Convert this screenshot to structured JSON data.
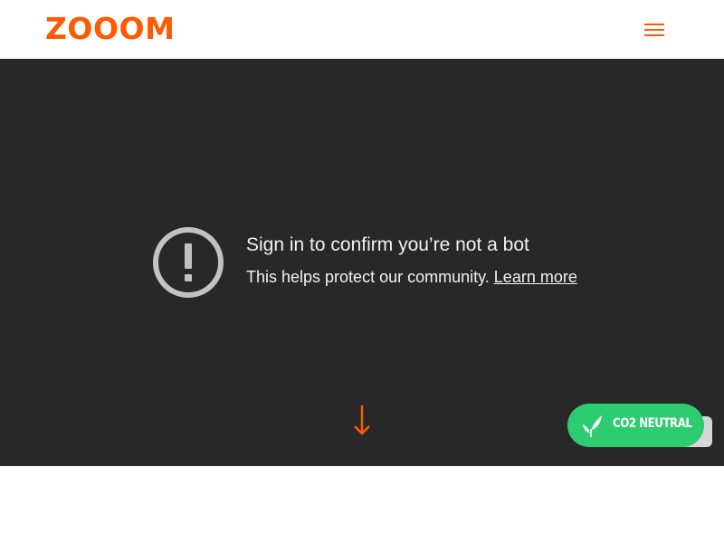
{
  "brand": {
    "logo_text": "ZOOOM",
    "accent_color": "#ff5a00"
  },
  "header": {
    "menu_icon": "hamburger-menu-icon"
  },
  "notice": {
    "icon": "exclamation-circle-icon",
    "title": "Sign in to confirm you’re not a bot",
    "subtitle": "This helps protect our community.",
    "link_label": "Learn more"
  },
  "hero": {
    "background_color": "#282828",
    "scroll_icon": "arrow-down-icon"
  },
  "co2_badge": {
    "label": "CO2 NEUTRAL",
    "icon": "leaf-icon",
    "color": "#2ecc71"
  }
}
